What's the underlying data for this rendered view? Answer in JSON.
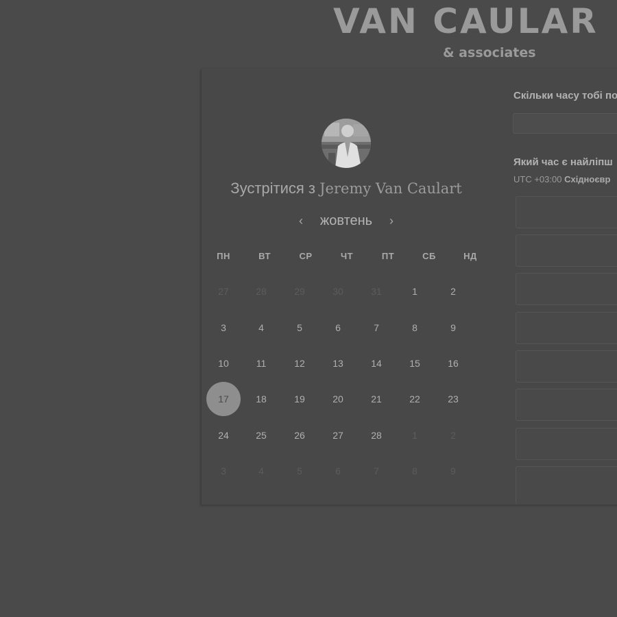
{
  "logo": {
    "main": "VAN CAULAR",
    "sub": "& associates"
  },
  "meeting": {
    "prefix": "Зустрітися з",
    "host": "Jeremy Van Caulart"
  },
  "calendar": {
    "month": "жовтень",
    "weekdays": [
      "ПН",
      "ВТ",
      "СР",
      "ЧТ",
      "ПТ",
      "СБ",
      "НД"
    ],
    "weeks": [
      [
        "27",
        "28",
        "29",
        "30",
        "31",
        "1",
        "2"
      ],
      [
        "3",
        "4",
        "5",
        "6",
        "7",
        "8",
        "9"
      ],
      [
        "10",
        "11",
        "12",
        "13",
        "14",
        "15",
        "16"
      ],
      [
        "17",
        "18",
        "19",
        "20",
        "21",
        "22",
        "23"
      ],
      [
        "24",
        "25",
        "26",
        "27",
        "28",
        "1",
        "2"
      ],
      [
        "3",
        "4",
        "5",
        "6",
        "7",
        "8",
        "9"
      ]
    ],
    "selected": "17"
  },
  "scheduler": {
    "duration_question": "Скільки часу тобі по",
    "time_question": "Який час є найліпш",
    "timezone_offset": "UTC +03:00",
    "timezone_name": "Східноєвр"
  }
}
